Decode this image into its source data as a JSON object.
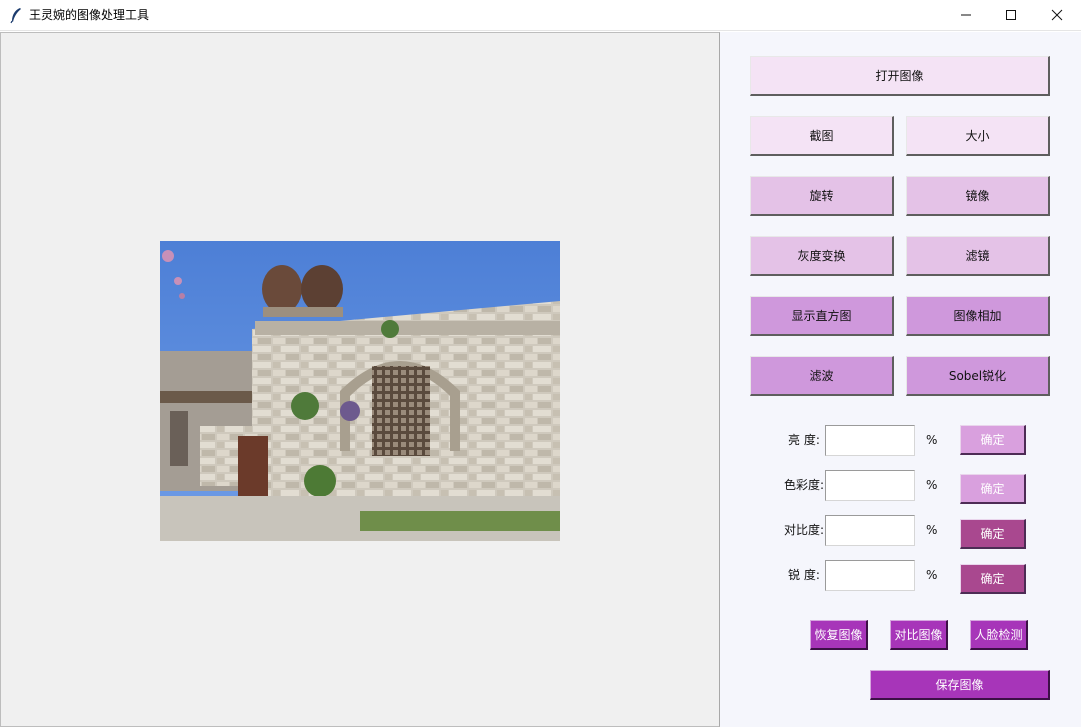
{
  "window": {
    "title": "王灵婉的图像处理工具"
  },
  "buttons": {
    "open_image": "打开图像",
    "crop": "截图",
    "resize": "大小",
    "rotate": "旋转",
    "mirror": "镜像",
    "gray_transform": "灰度变换",
    "filter_effect": "滤镜",
    "show_histogram": "显示直方图",
    "image_add": "图像相加",
    "smoothing": "滤波",
    "sobel": "Sobel锐化"
  },
  "adjustments": [
    {
      "label": "亮 度:",
      "value": "",
      "unit": "%",
      "confirm": "确定"
    },
    {
      "label": "色彩度:",
      "value": "",
      "unit": "%",
      "confirm": "确定"
    },
    {
      "label": "对比度:",
      "value": "",
      "unit": "%",
      "confirm": "确定"
    },
    {
      "label": "锐 度:",
      "value": "",
      "unit": "%",
      "confirm": "确定"
    }
  ],
  "actions": {
    "restore": "恢复图像",
    "compare": "对比图像",
    "face_detect": "人脸检测",
    "save": "保存图像"
  },
  "colors": {
    "button_row_1": "#f4e3f5",
    "button_row_2": "#e4c2e7",
    "button_row_3": "#cf98dc",
    "confirm_light": "#d9a0de",
    "confirm_dark": "#a9488f",
    "action_purple": "#a735b9"
  },
  "icons": {
    "app": "feather-icon",
    "minimize": "minimize-icon",
    "maximize": "maximize-icon",
    "close": "close-icon"
  }
}
